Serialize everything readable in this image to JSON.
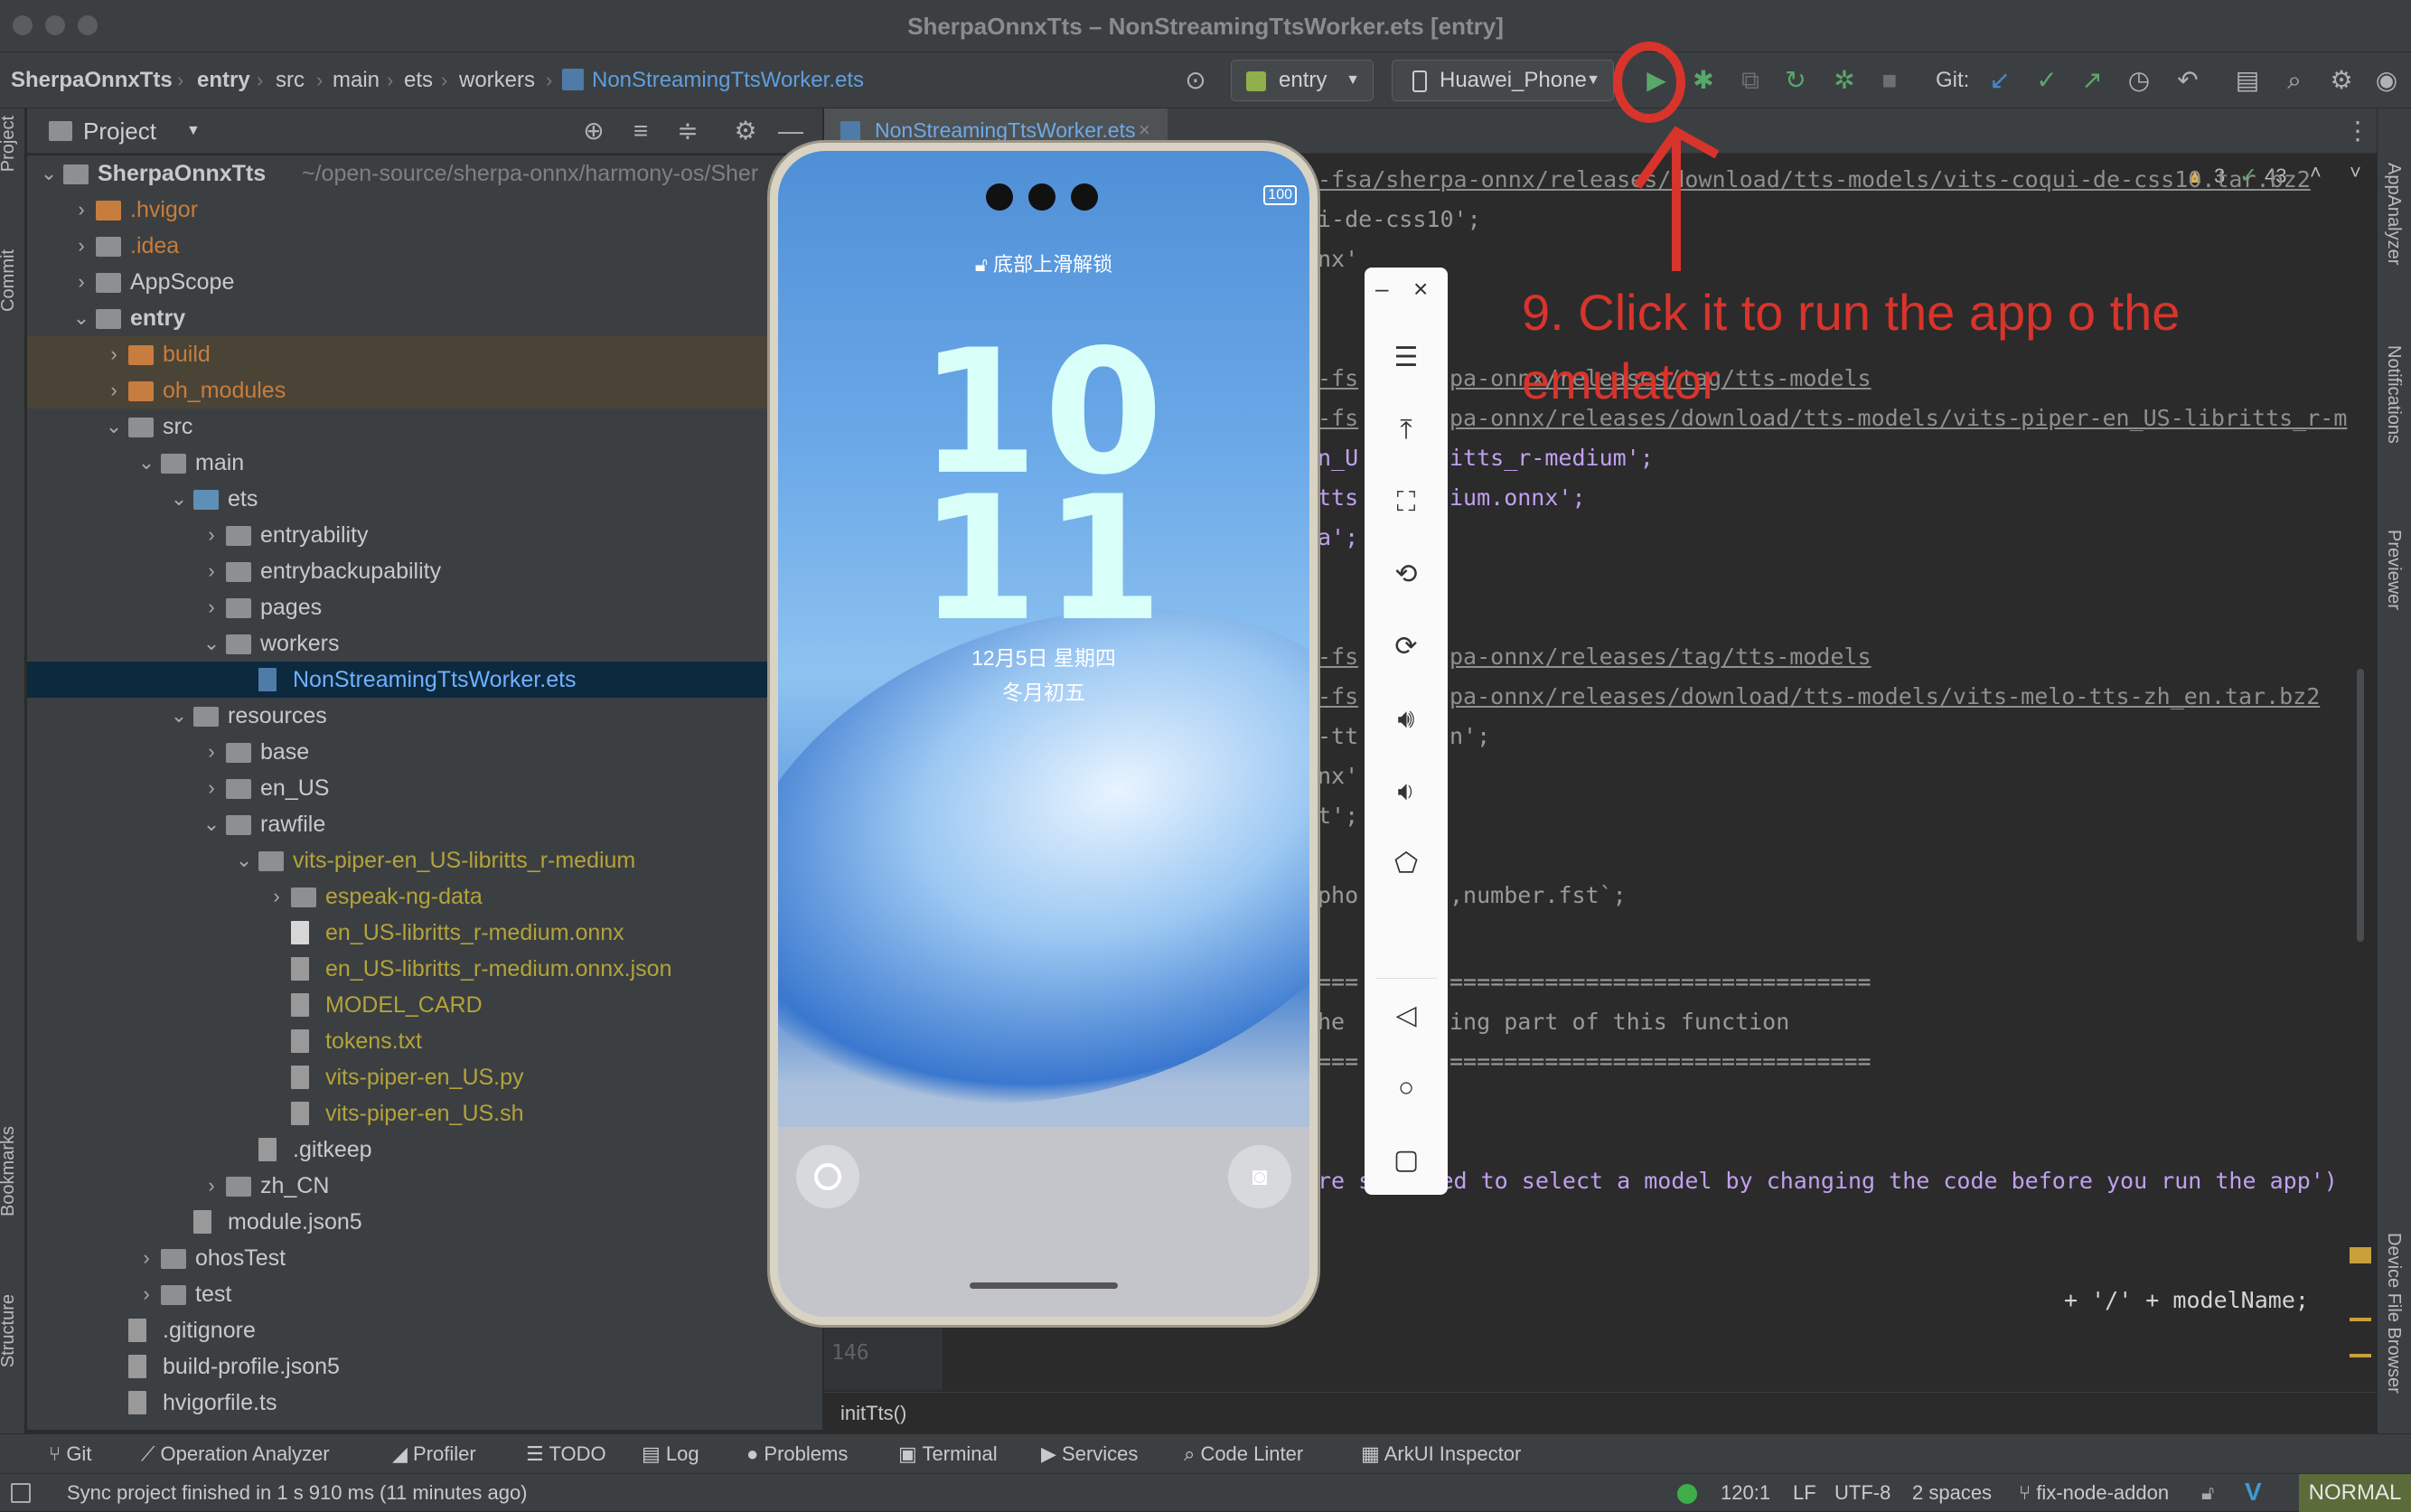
{
  "window": {
    "title": "SherpaOnnxTts – NonStreamingTtsWorker.ets [entry]"
  },
  "breadcrumb": [
    "SherpaOnnxTts",
    "entry",
    "src",
    "main",
    "ets",
    "workers",
    "NonStreamingTtsWorker.ets"
  ],
  "toolbar": {
    "module_combo": "entry",
    "device_combo": "Huawei_Phone",
    "git_label": "Git:"
  },
  "project_panel": {
    "title": "Project"
  },
  "tree": [
    {
      "label": "SherpaOnnxTts",
      "suffix": "~/open-source/sherpa-onnx/harmony-os/Sher",
      "depth": 0,
      "arrow": "v",
      "kind": "root",
      "bold": true
    },
    {
      "label": ".hvigor",
      "depth": 1,
      "arrow": ">",
      "kind": "fold-o",
      "color": "o"
    },
    {
      "label": ".idea",
      "depth": 1,
      "arrow": ">",
      "kind": "fold",
      "color": "o"
    },
    {
      "label": "AppScope",
      "depth": 1,
      "arrow": ">",
      "kind": "fold"
    },
    {
      "label": "entry",
      "depth": 1,
      "arrow": "v",
      "kind": "fold",
      "bold": true
    },
    {
      "label": "build",
      "depth": 2,
      "arrow": ">",
      "kind": "fold-o",
      "color": "o",
      "hl": true
    },
    {
      "label": "oh_modules",
      "depth": 2,
      "arrow": ">",
      "kind": "fold-o",
      "color": "o",
      "hl": true
    },
    {
      "label": "src",
      "depth": 2,
      "arrow": "v",
      "kind": "fold"
    },
    {
      "label": "main",
      "depth": 3,
      "arrow": "v",
      "kind": "fold"
    },
    {
      "label": "ets",
      "depth": 4,
      "arrow": "v",
      "kind": "fold-b"
    },
    {
      "label": "entryability",
      "depth": 5,
      "arrow": ">",
      "kind": "fold"
    },
    {
      "label": "entrybackupability",
      "depth": 5,
      "arrow": ">",
      "kind": "fold"
    },
    {
      "label": "pages",
      "depth": 5,
      "arrow": ">",
      "kind": "fold"
    },
    {
      "label": "workers",
      "depth": 5,
      "arrow": "v",
      "kind": "fold"
    },
    {
      "label": "NonStreamingTtsWorker.ets",
      "depth": 6,
      "arrow": "",
      "kind": "file",
      "color": "sel",
      "selected": true
    },
    {
      "label": "resources",
      "depth": 4,
      "arrow": "v",
      "kind": "fold"
    },
    {
      "label": "base",
      "depth": 5,
      "arrow": ">",
      "kind": "fold"
    },
    {
      "label": "en_US",
      "depth": 5,
      "arrow": ">",
      "kind": "fold"
    },
    {
      "label": "rawfile",
      "depth": 5,
      "arrow": "v",
      "kind": "fold"
    },
    {
      "label": "vits-piper-en_US-libritts_r-medium",
      "depth": 6,
      "arrow": "v",
      "kind": "fold",
      "color": "y"
    },
    {
      "label": "espeak-ng-data",
      "depth": 7,
      "arrow": ">",
      "kind": "fold",
      "color": "y"
    },
    {
      "label": "en_US-libritts_r-medium.onnx",
      "depth": 7,
      "arrow": "",
      "kind": "file",
      "color": "y"
    },
    {
      "label": "en_US-libritts_r-medium.onnx.json",
      "depth": 7,
      "arrow": "",
      "kind": "filed",
      "color": "y"
    },
    {
      "label": "MODEL_CARD",
      "depth": 7,
      "arrow": "",
      "kind": "filed",
      "color": "y"
    },
    {
      "label": "tokens.txt",
      "depth": 7,
      "arrow": "",
      "kind": "filed",
      "color": "y"
    },
    {
      "label": "vits-piper-en_US.py",
      "depth": 7,
      "arrow": "",
      "kind": "filed",
      "color": "y"
    },
    {
      "label": "vits-piper-en_US.sh",
      "depth": 7,
      "arrow": "",
      "kind": "filed",
      "color": "y"
    },
    {
      "label": ".gitkeep",
      "depth": 6,
      "arrow": "",
      "kind": "filed"
    },
    {
      "label": "zh_CN",
      "depth": 5,
      "arrow": ">",
      "kind": "fold"
    },
    {
      "label": "module.json5",
      "depth": 4,
      "arrow": "",
      "kind": "filed"
    },
    {
      "label": "ohosTest",
      "depth": 3,
      "arrow": ">",
      "kind": "fold"
    },
    {
      "label": "test",
      "depth": 3,
      "arrow": ">",
      "kind": "fold"
    },
    {
      "label": ".gitignore",
      "depth": 2,
      "arrow": "",
      "kind": "filed"
    },
    {
      "label": "build-profile.json5",
      "depth": 2,
      "arrow": "",
      "kind": "filed"
    },
    {
      "label": "hvigorfile.ts",
      "depth": 2,
      "arrow": "",
      "kind": "filed"
    }
  ],
  "editor": {
    "tab": "NonStreamingTtsWorker.ets",
    "warnings": "3",
    "checks": "43",
    "breadcrumb_fn": "initTts()",
    "line_number": "146",
    "lines": [
      {
        "text": "-fsa/sherpa-onnx/releases/download/tts-models/vits-coqui-de-css10.tar.bz2",
        "cls": "c-link"
      },
      {
        "text": "i-de-css10';",
        "cls": "c-dim"
      },
      {
        "text": "nx'",
        "cls": "c-dim"
      },
      {
        "text": "-fs",
        "cls": "c-link"
      },
      {
        "text": "pa-onnx/releases/tag/tts-models",
        "cls": "c-link"
      },
      {
        "text": "-fs",
        "cls": "c-link"
      },
      {
        "text": "pa-onnx/releases/download/tts-models/vits-piper-en_US-libritts_r-m",
        "cls": "c-link"
      },
      {
        "text": "n_U",
        "cls": "c-mag"
      },
      {
        "text": "itts_r-medium';",
        "cls": "c-mag"
      },
      {
        "text": "tts",
        "cls": "c-mag"
      },
      {
        "text": "ium.onnx';",
        "cls": "c-mag"
      },
      {
        "text": "a';",
        "cls": "c-mag"
      },
      {
        "text": "-fs",
        "cls": "c-link"
      },
      {
        "text": "pa-onnx/releases/tag/tts-models",
        "cls": "c-link"
      },
      {
        "text": "-fs",
        "cls": "c-link"
      },
      {
        "text": "pa-onnx/releases/download/tts-models/vits-melo-tts-zh_en.tar.bz2",
        "cls": "c-link"
      },
      {
        "text": "-tt",
        "cls": "c-dim"
      },
      {
        "text": "n';",
        "cls": "c-dim"
      },
      {
        "text": "nx'",
        "cls": "c-dim"
      },
      {
        "text": "t';",
        "cls": "c-dim"
      },
      {
        "text": "pho",
        "cls": "c-dim"
      },
      {
        "text": ",number.fst`;",
        "cls": "c-dim"
      },
      {
        "text": "===",
        "cls": "c-dim"
      },
      {
        "text": "===============================",
        "cls": "c-dim"
      },
      {
        "text": "he",
        "cls": "c-dim"
      },
      {
        "text": "ing part of this function",
        "cls": "c-dim"
      },
      {
        "text": "===",
        "cls": "c-dim"
      },
      {
        "text": "===============================",
        "cls": "c-dim"
      },
      {
        "text": "re supposed to select a model by changing the code before you run the app')",
        "cls": "c-mag"
      },
      {
        "text": "+ '/' + modelName;",
        "cls": "c-w"
      }
    ]
  },
  "emulator": {
    "lock_text": "底部上滑解锁",
    "hour": "10",
    "minute": "11",
    "date": "12月5日  星期四",
    "lunar": "冬月初五",
    "battery": "100"
  },
  "annotation": {
    "text": "9. Click it to run the app o the emulator",
    "color": "#d8342c"
  },
  "bottom_tools": [
    "Git",
    "Operation Analyzer",
    "Profiler",
    "TODO",
    "Log",
    "Problems",
    "Terminal",
    "Services",
    "Code Linter",
    "ArkUI Inspector"
  ],
  "status": {
    "message": "Sync project finished in 1 s 910 ms (11 minutes ago)",
    "position": "120:1",
    "line_sep": "LF",
    "encoding": "UTF-8",
    "indent": "2 spaces",
    "branch": "fix-node-addon",
    "mode": "NORMAL"
  },
  "side_tabs": {
    "left": [
      "Project",
      "Commit",
      "Bookmarks",
      "Structure"
    ],
    "right": [
      "AppAnalyzer",
      "Notifications",
      "Previewer",
      "Device File Browser"
    ]
  }
}
